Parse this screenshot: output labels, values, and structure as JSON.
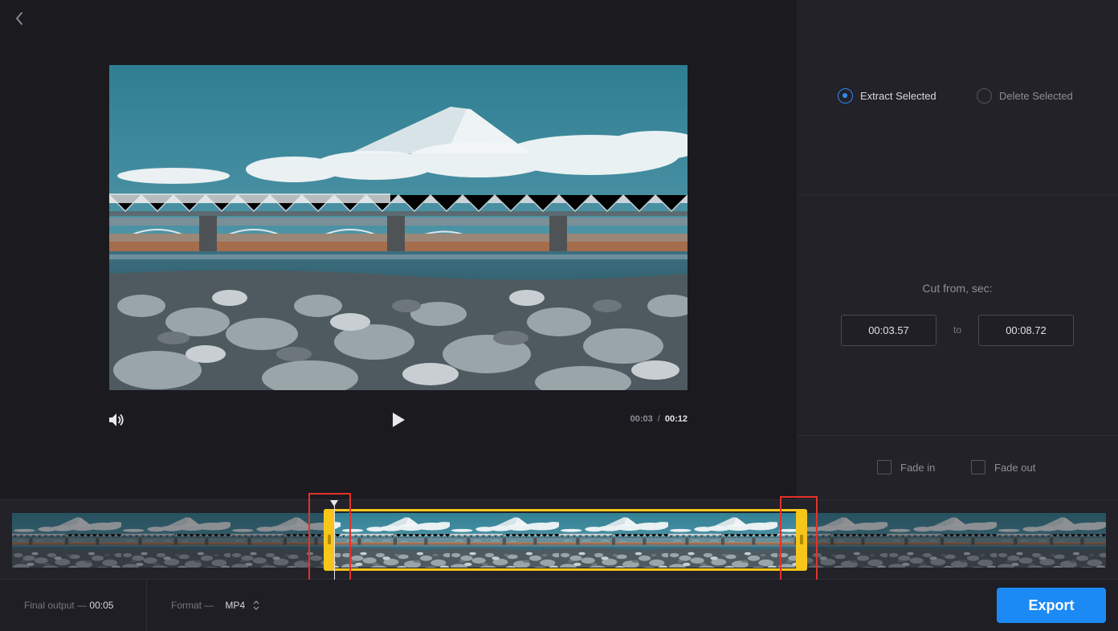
{
  "player": {
    "current_time": "00:03",
    "separator": "/",
    "duration": "00:12"
  },
  "mode": {
    "extract_label": "Extract Selected",
    "delete_label": "Delete Selected",
    "selected": "extract"
  },
  "cut": {
    "title": "Cut from, sec:",
    "from": "00:03.57",
    "to_label": "to",
    "to": "00:08.72"
  },
  "fade": {
    "fade_in_label": "Fade in",
    "fade_out_label": "Fade out"
  },
  "footer": {
    "final_output_label": "Final output —",
    "final_output_value": "00:05",
    "format_label": "Format —",
    "format_value": "MP4",
    "export_label": "Export"
  },
  "colors": {
    "accent": "#1c8af5",
    "selection": "#f7c61b",
    "highlight": "#e8302a"
  },
  "icons": {
    "back": "chevron-left-icon",
    "volume": "volume-icon",
    "play": "play-icon",
    "format_toggle": "up-down-arrows-icon"
  }
}
